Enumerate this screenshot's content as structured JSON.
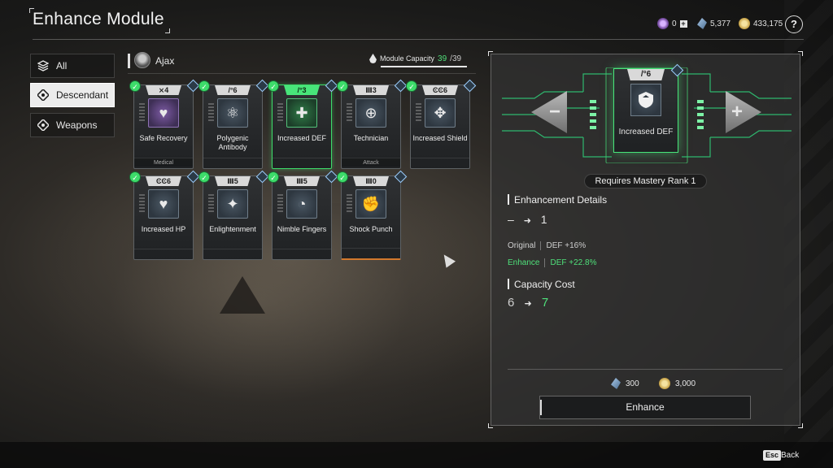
{
  "header": {
    "title": "Enhance Module",
    "currencies": [
      {
        "icon": "purple-token-icon",
        "value": "0"
      },
      {
        "icon": "kuiper-crystal-icon",
        "value": "5,377"
      },
      {
        "icon": "gold-coin-icon",
        "value": "433,175"
      }
    ],
    "help_label": "?"
  },
  "nav": [
    {
      "label": "All",
      "icon": "layers-icon",
      "active": false
    },
    {
      "label": "Descendant",
      "icon": "descendant-icon",
      "active": true
    },
    {
      "label": "Weapons",
      "icon": "weapons-icon",
      "active": false
    }
  ],
  "descendant": {
    "name": "Ajax",
    "capacity_label": "Module Capacity",
    "capacity_value": "39",
    "capacity_max": "/39"
  },
  "modules": [
    {
      "cost": "4",
      "name": "Safe Recovery",
      "type": "Medical",
      "glyph": "♥",
      "selected": false
    },
    {
      "cost": "6",
      "name": "Polygenic Antibody",
      "type": "",
      "glyph": "⚛",
      "selected": false
    },
    {
      "cost": "3",
      "name": "Increased DEF",
      "type": "",
      "glyph": "✚",
      "selected": true
    },
    {
      "cost": "3",
      "name": "Technician",
      "type": "Attack",
      "glyph": "⊕",
      "selected": false
    },
    {
      "cost": "6",
      "name": "Increased Shield",
      "type": "",
      "glyph": "✥",
      "selected": false
    },
    {
      "cost": "6",
      "name": "Increased HP",
      "type": "",
      "glyph": "♥",
      "selected": false
    },
    {
      "cost": "5",
      "name": "Enlightenment",
      "type": "",
      "glyph": "✦",
      "selected": false
    },
    {
      "cost": "5",
      "name": "Nimble Fingers",
      "type": "",
      "glyph": "◔",
      "selected": false
    },
    {
      "cost": "0",
      "name": "Shock Punch",
      "type": "",
      "glyph": "✊",
      "selected": false
    }
  ],
  "detail": {
    "module_name": "Increased DEF",
    "module_cost": "6",
    "mastery": "Requires Mastery Rank 1",
    "enhancement_title": "Enhancement Details",
    "level_from": "–",
    "level_to": "1",
    "original_label": "Original",
    "original_value": "DEF +16%",
    "enhance_label": "Enhance",
    "enhance_value": "DEF +22.8%",
    "capacity_title": "Capacity Cost",
    "cap_from": "6",
    "cap_to": "7",
    "cost_crystal": "300",
    "cost_gold": "3,000",
    "button_label": "Enhance",
    "minus_label": "−",
    "plus_label": "+",
    "accent_color": "#48e57a"
  },
  "footer": {
    "esc_label": "Esc",
    "back_label": "Back"
  }
}
